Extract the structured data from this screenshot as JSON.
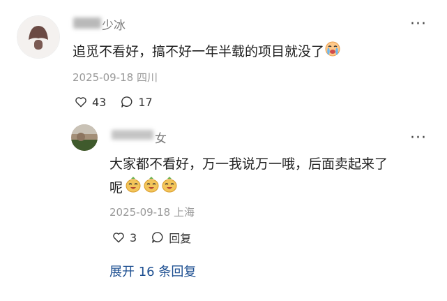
{
  "comment": {
    "author_suffix": "少冰",
    "text": "追觅不看好，搞不好一年半载的项目就没了",
    "time": "2025-09-18",
    "location": "四川",
    "likes": "43",
    "replies": "17",
    "emoji": "crying-face-emoji"
  },
  "reply": {
    "author_suffix": "女",
    "text_line1": "大家都不看好，万一我说万一哦，后面卖起来了",
    "text_line2": "呢",
    "time": "2025-09-18",
    "location": "上海",
    "likes": "3",
    "reply_label": "回复",
    "emoji": "laughing-face-emoji"
  },
  "expand_label": "展开 16 条回复",
  "colors": {
    "link": "#1d4f91",
    "meta": "#999999"
  }
}
